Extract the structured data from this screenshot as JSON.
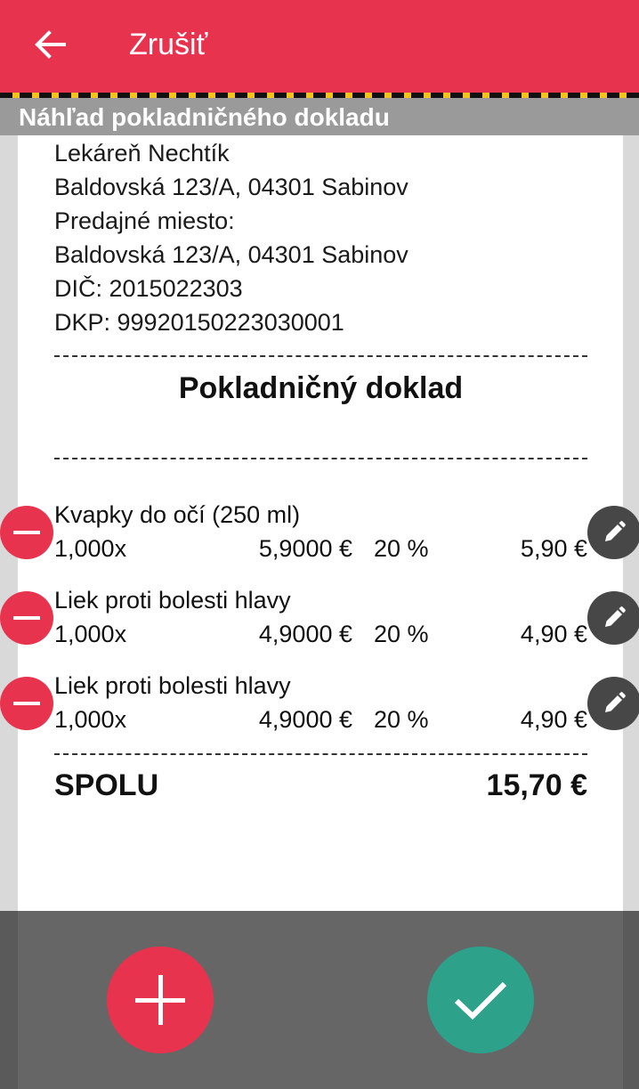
{
  "toolbar": {
    "cancel_label": "Zrušiť",
    "back_icon": "arrow-left-icon"
  },
  "header": {
    "title": "Náhľad pokladničného dokladu"
  },
  "receipt": {
    "shop_lines": [
      "Lekáreň Nechtík",
      "Baldovská 123/A, 04301 Sabinov",
      "Predajné miesto:",
      "Baldovská 123/A, 04301 Sabinov",
      "DIČ: 2015022303",
      "DKP: 99920150223030001"
    ],
    "doc_title": "Pokladničný doklad",
    "items": [
      {
        "name": "Kvapky do očí (250 ml)",
        "qty": "1,000x",
        "unit_price": "5,9000 €",
        "vat": "20 %",
        "total": "5,90 €"
      },
      {
        "name": "Liek proti bolesti hlavy",
        "qty": "1,000x",
        "unit_price": "4,9000 €",
        "vat": "20 %",
        "total": "4,90 €"
      },
      {
        "name": "Liek proti bolesti hlavy",
        "qty": "1,000x",
        "unit_price": "4,9000 €",
        "vat": "20 %",
        "total": "4,90 €"
      }
    ],
    "total_label": "SPOLU",
    "total_value": "15,70 €"
  },
  "actions": {
    "add_icon": "plus-icon",
    "confirm_icon": "check-icon"
  },
  "colors": {
    "accent": "#e8334f",
    "confirm": "#2ea18a",
    "edit": "#474747"
  }
}
